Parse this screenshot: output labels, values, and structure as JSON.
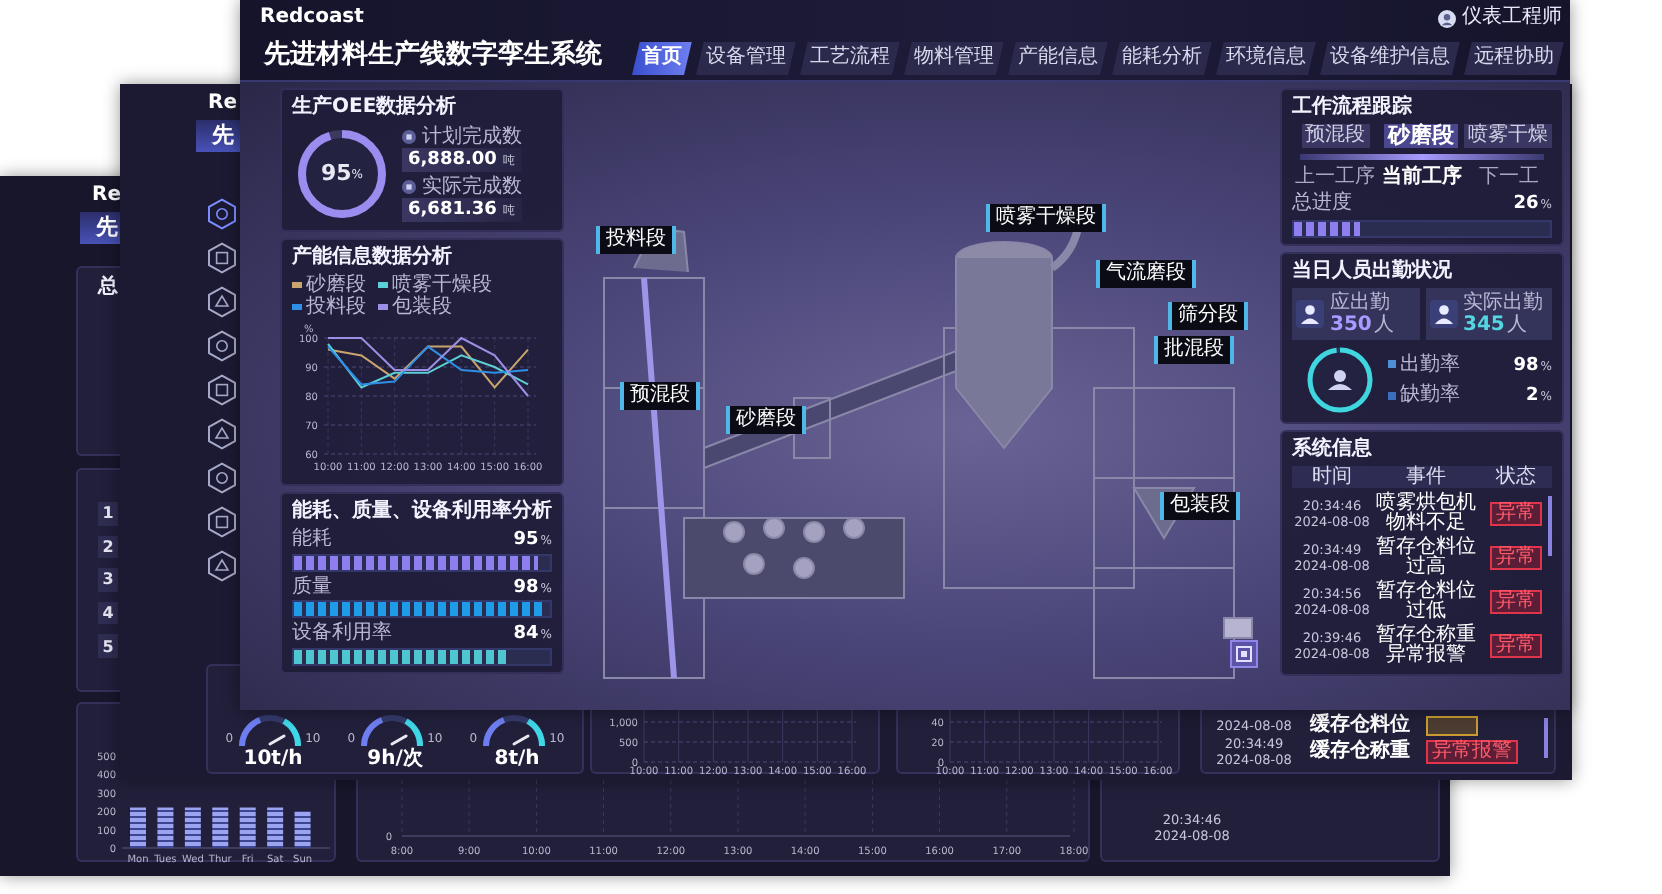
{
  "back_window": {
    "logo": "Re",
    "title": "先",
    "summary_panel": {
      "title": "总"
    },
    "rank_panel": {
      "ranks": [
        "1",
        "2",
        "3",
        "4",
        "5"
      ]
    },
    "daily_panel": {
      "chart_data": {
        "type": "bar",
        "categories": [
          "Mon",
          "Tues",
          "Wed",
          "Thur",
          "Fri",
          "Sat",
          "Sun"
        ],
        "values": [
          220,
          220,
          220,
          220,
          220,
          220,
          200
        ],
        "ylim": [
          0,
          500
        ],
        "yticks": [
          0,
          100,
          200,
          300,
          400,
          500
        ]
      }
    },
    "trend_panel": {
      "yticks": [
        "0"
      ],
      "xticks": [
        "8:00",
        "9:00",
        "10:00",
        "11:00",
        "12:00",
        "13:00",
        "14:00",
        "15:00",
        "16:00",
        "17:00",
        "18:00"
      ]
    },
    "event_panel": {
      "rows": [
        {
          "time": "20:34:46",
          "date": "2024-08-08"
        }
      ]
    }
  },
  "middle_window": {
    "logo": "Re",
    "title": "先",
    "sidebar": [
      {
        "selected": true
      },
      {
        "selected": false
      },
      {
        "selected": false
      },
      {
        "selected": false
      },
      {
        "selected": false
      },
      {
        "selected": false
      },
      {
        "selected": false
      },
      {
        "selected": false
      },
      {
        "selected": false
      }
    ],
    "gauges": [
      {
        "min": "0",
        "max": "10",
        "reading": "10t/h"
      },
      {
        "min": "0",
        "max": "10",
        "reading": "9h/次"
      },
      {
        "min": "0",
        "max": "10",
        "reading": "8t/h"
      }
    ],
    "charts": [
      {
        "yticks": [
          "1,000",
          "500",
          "0"
        ],
        "xticks": [
          "10:00",
          "11:00",
          "12:00",
          "13:00",
          "14:00",
          "15:00",
          "16:00"
        ]
      },
      {
        "yticks": [
          "40",
          "20",
          "0"
        ],
        "xticks": [
          "10:00",
          "11:00",
          "12:00",
          "13:00",
          "14:00",
          "15:00",
          "16:00"
        ]
      }
    ],
    "events": [
      {
        "date": "2024-08-08",
        "event": "缓存仓料位",
        "kind": "warning"
      },
      {
        "time": "20:34:49",
        "date": "2024-08-08",
        "event": "缓存仓称重",
        "status": "异常报警",
        "kind": "alarm"
      }
    ]
  },
  "front_window": {
    "logo": "Redcoast",
    "title": "先进材料生产线数字孪生系统",
    "user": "仪表工程师",
    "tabs": [
      {
        "label": "首页",
        "selected": true
      },
      {
        "label": "设备管理",
        "selected": false
      },
      {
        "label": "工艺流程",
        "selected": false
      },
      {
        "label": "物料管理",
        "selected": false
      },
      {
        "label": "产能信息",
        "selected": false
      },
      {
        "label": "能耗分析",
        "selected": false
      },
      {
        "label": "环境信息",
        "selected": false
      },
      {
        "label": "设备维护信息",
        "selected": false
      },
      {
        "label": "远程协助",
        "selected": false
      }
    ],
    "oee_panel": {
      "title": "生产OEE数据分析",
      "level": 0.95,
      "percent": "95",
      "unit": "%",
      "items": [
        {
          "label": "计划完成数",
          "value": "6,888.00",
          "unit": "吨"
        },
        {
          "label": "实际完成数",
          "value": "6,681.36",
          "unit": "吨"
        }
      ]
    },
    "capacity_panel": {
      "title": "产能信息数据分析",
      "chart_data": {
        "type": "line",
        "ylabel": "%",
        "grid": true,
        "categories": [
          "10:00",
          "11:00",
          "12:00",
          "13:00",
          "14:00",
          "15:00",
          "16:00"
        ],
        "ylim": [
          60,
          100
        ],
        "yticks": [
          60,
          70,
          80,
          90,
          100
        ],
        "series": [
          {
            "name": "砂磨段",
            "color": "#c9a46e",
            "values": [
              96,
              94,
              86,
              97,
              97,
              83,
              96
            ]
          },
          {
            "name": "喷雾干燥段",
            "color": "#5ccfd6",
            "values": [
              98,
              83,
              88,
              88,
              94,
              90,
              84
            ]
          },
          {
            "name": "投料段",
            "color": "#2e8fe6",
            "values": [
              97,
              84,
              85,
              97,
              89,
              88,
              89
            ]
          },
          {
            "name": "包装段",
            "color": "#9c8fe6",
            "values": [
              100,
              100,
              89,
              89,
              100,
              94,
              80
            ]
          }
        ]
      }
    },
    "utilization_panel": {
      "title": "能耗、质量、设备利用率分析",
      "metrics": [
        {
          "label": "能耗",
          "value": "95",
          "unit": "%",
          "level": 0.95,
          "color": "#8f7ef0"
        },
        {
          "label": "质量",
          "value": "98",
          "unit": "%",
          "level": 0.98,
          "color": "#1f9be8"
        },
        {
          "label": "设备利用率",
          "value": "84",
          "unit": "%",
          "level": 0.84,
          "color": "#4fc6cf"
        }
      ]
    },
    "scene": {
      "labels": [
        "投料段",
        "喷雾干燥段",
        "气流磨段",
        "筛分段",
        "批混段",
        "预混段",
        "砂磨段",
        "包装段"
      ]
    },
    "process_panel": {
      "title": "工作流程跟踪",
      "steps": [
        {
          "name": "预混段",
          "caption": "上一工序",
          "selected": false
        },
        {
          "name": "砂磨段",
          "caption": "当前工序",
          "selected": true
        },
        {
          "name": "喷雾干燥",
          "caption": "下一工",
          "selected": false
        }
      ],
      "progress_label": "总进度",
      "progress_value": "26",
      "unit": "%",
      "level": 0.26
    },
    "attendance_panel": {
      "title": "当日人员出勤状况",
      "cards": [
        {
          "label": "应出勤",
          "value": "350",
          "unit": "人",
          "color": "#a99bff"
        },
        {
          "label": "实际出勤",
          "value": "345",
          "unit": "人",
          "color": "#53d6e0"
        }
      ],
      "level": 0.98,
      "rates": [
        {
          "label": "出勤率",
          "value": "98",
          "unit": "%",
          "color": "#4f8fd8"
        },
        {
          "label": "缺勤率",
          "value": "2",
          "unit": "%",
          "color": "#3a6fc0"
        }
      ]
    },
    "system_panel": {
      "title": "系统信息",
      "columns": [
        "时间",
        "事件",
        "状态"
      ],
      "rows": [
        {
          "time": "20:34:46",
          "date": "2024-08-08",
          "event": "喷雾烘包机物料不足",
          "status": "异常"
        },
        {
          "time": "20:34:49",
          "date": "2024-08-08",
          "event": "暂存仓料位过高",
          "status": "异常"
        },
        {
          "time": "20:34:56",
          "date": "2024-08-08",
          "event": "暂存仓料位过低",
          "status": "异常"
        },
        {
          "time": "20:39:46",
          "date": "2024-08-08",
          "event": "暂存仓称重异常报警",
          "status": "异常"
        }
      ]
    }
  }
}
